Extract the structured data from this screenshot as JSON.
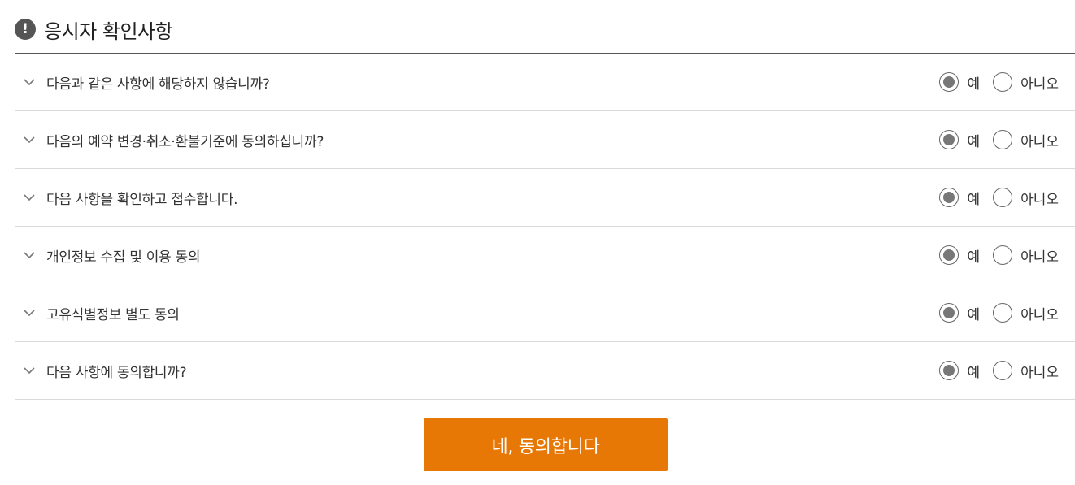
{
  "header": {
    "title": "응시자 확인사항",
    "icon": "exclamation-icon"
  },
  "options": {
    "yes_label": "예",
    "no_label": "아니오"
  },
  "items": [
    {
      "label": "다음과 같은 사항에 해당하지 않습니까?",
      "selected": "yes"
    },
    {
      "label": "다음의 예약 변경·취소·환불기준에 동의하십니까?",
      "selected": "yes"
    },
    {
      "label": "다음 사항을 확인하고 접수합니다.",
      "selected": "yes"
    },
    {
      "label": "개인정보 수집 및 이용 동의",
      "selected": "yes"
    },
    {
      "label": "고유식별정보 별도 동의",
      "selected": "yes"
    },
    {
      "label": "다음 사항에 동의합니까?",
      "selected": "yes"
    }
  ],
  "submit": {
    "label": "네, 동의합니다"
  },
  "colors": {
    "accent": "#e87805",
    "radio_selected": "#777777",
    "divider": "#d9d9d9"
  }
}
